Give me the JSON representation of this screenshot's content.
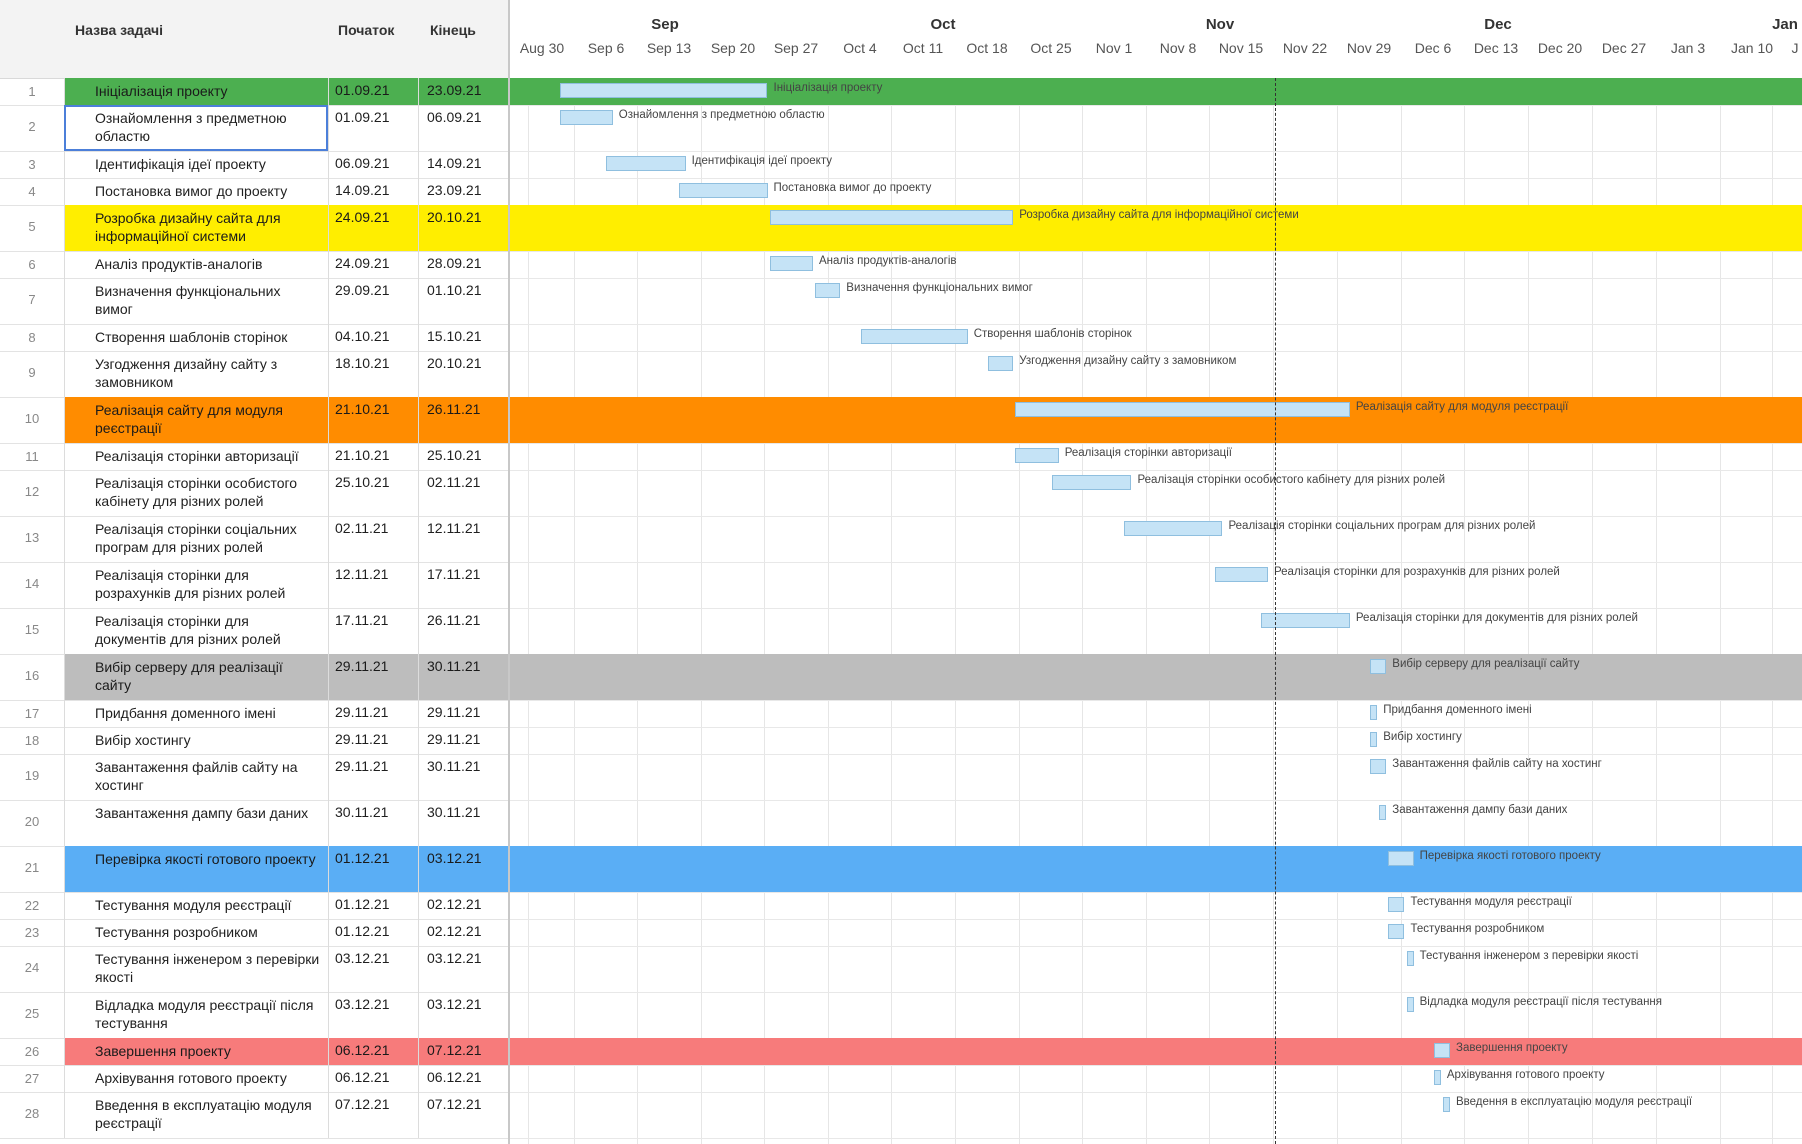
{
  "grid": {
    "columns": [
      "Назва задачі",
      "Початок",
      "Кінець"
    ]
  },
  "timeline": {
    "months": [
      "Sep",
      "Oct",
      "Nov",
      "Dec",
      "Jan"
    ],
    "weeks": [
      "Aug 30",
      "Sep 6",
      "Sep 13",
      "Sep 20",
      "Sep 27",
      "Oct 4",
      "Oct 11",
      "Oct 18",
      "Oct 25",
      "Nov 1",
      "Nov 8",
      "Nov 15",
      "Nov 22",
      "Nov 29",
      "Dec 6",
      "Dec 13",
      "Dec 20",
      "Dec 27",
      "Jan 3",
      "Jan 10",
      "J"
    ]
  },
  "tasks": [
    {
      "num": "1",
      "name": "Ініціалізація проекту",
      "start": "01.09.21",
      "end": "23.09.21",
      "group": true,
      "color": "#4caf50",
      "text_color": "#1a1a1a"
    },
    {
      "num": "2",
      "name": "Ознайомлення з предметною областю",
      "start": "01.09.21",
      "end": "06.09.21"
    },
    {
      "num": "3",
      "name": "Ідентифікація ідеї проекту",
      "start": "06.09.21",
      "end": "14.09.21"
    },
    {
      "num": "4",
      "name": "Постановка вимог до проекту",
      "start": "14.09.21",
      "end": "23.09.21"
    },
    {
      "num": "5",
      "name": "Розробка дизайну сайта для інформаційної системи",
      "start": "24.09.21",
      "end": "20.10.21",
      "group": true,
      "color": "#ffee00",
      "text_color": "#1a1a1a"
    },
    {
      "num": "6",
      "name": "Аналіз продуктів-аналогів",
      "start": "24.09.21",
      "end": "28.09.21"
    },
    {
      "num": "7",
      "name": "Визначення функціональних вимог",
      "start": "29.09.21",
      "end": "01.10.21"
    },
    {
      "num": "8",
      "name": "Створення шаблонів сторінок",
      "start": "04.10.21",
      "end": "15.10.21"
    },
    {
      "num": "9",
      "name": "Узгодження дизайну сайту з замовником",
      "start": "18.10.21",
      "end": "20.10.21"
    },
    {
      "num": "10",
      "name": "Реалізація сайту для модуля реєстрації",
      "start": "21.10.21",
      "end": "26.11.21",
      "group": true,
      "color": "#ff8c00",
      "text_color": "#1a1a1a"
    },
    {
      "num": "11",
      "name": "Реалізація сторінки авторизації",
      "start": "21.10.21",
      "end": "25.10.21"
    },
    {
      "num": "12",
      "name": "Реалізація сторінки особистого кабінету для різних ролей",
      "start": "25.10.21",
      "end": "02.11.21"
    },
    {
      "num": "13",
      "name": "Реалізація сторінки соціальних програм для різних ролей",
      "start": "02.11.21",
      "end": "12.11.21"
    },
    {
      "num": "14",
      "name": "Реалізація сторінки для розрахунків для різних ролей",
      "start": "12.11.21",
      "end": "17.11.21"
    },
    {
      "num": "15",
      "name": "Реалізація сторінки для документів для різних ролей",
      "start": "17.11.21",
      "end": "26.11.21"
    },
    {
      "num": "16",
      "name": "Вибір серверу для реалізації сайту",
      "start": "29.11.21",
      "end": "30.11.21",
      "group": true,
      "color": "#bdbdbd",
      "text_color": "#1a1a1a"
    },
    {
      "num": "17",
      "name": "Придбання доменного імені",
      "start": "29.11.21",
      "end": "29.11.21"
    },
    {
      "num": "18",
      "name": "Вибір хостингу",
      "start": "29.11.21",
      "end": "29.11.21"
    },
    {
      "num": "19",
      "name": "Завантаження файлів сайту на хостинг",
      "start": "29.11.21",
      "end": "30.11.21"
    },
    {
      "num": "20",
      "name": "Завантаження дампу бази даних",
      "start": "30.11.21",
      "end": "30.11.21"
    },
    {
      "num": "21",
      "name": "Перевірка якості готового проекту",
      "start": "01.12.21",
      "end": "03.12.21",
      "group": true,
      "color": "#5aaef5",
      "text_color": "#1a1a1a"
    },
    {
      "num": "22",
      "name": "Тестування модуля реєстрації",
      "start": "01.12.21",
      "end": "02.12.21"
    },
    {
      "num": "23",
      "name": "Тестування розробником",
      "start": "01.12.21",
      "end": "02.12.21"
    },
    {
      "num": "24",
      "name": "Тестування інженером з перевірки якості",
      "start": "03.12.21",
      "end": "03.12.21"
    },
    {
      "num": "25",
      "name": "Відладка модуля реєстрації після тестування",
      "start": "03.12.21",
      "end": "03.12.21"
    },
    {
      "num": "26",
      "name": "Завершення проекту",
      "start": "06.12.21",
      "end": "07.12.21",
      "group": true,
      "color": "#f77b7b",
      "text_color": "#1a1a1a"
    },
    {
      "num": "27",
      "name": "Архівування готового проекту",
      "start": "06.12.21",
      "end": "06.12.21"
    },
    {
      "num": "28",
      "name": "Введення в експлуатацію модуля реєстрації",
      "start": "07.12.21",
      "end": "07.12.21"
    }
  ],
  "today": "Nov 18"
}
